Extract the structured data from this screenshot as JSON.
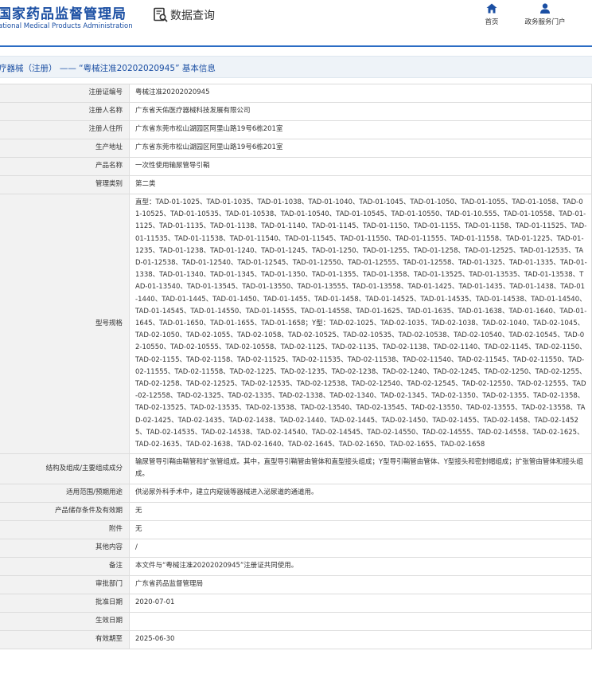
{
  "header": {
    "logo_cn": "国家药品监督管理局",
    "logo_en": "ational Medical Products Administration",
    "query_title": "数据查询",
    "nav": [
      {
        "label": "首页",
        "icon": "home-icon"
      },
      {
        "label": "政务服务门户",
        "icon": "user-icon"
      }
    ],
    "accent_color": "#1b4fa3"
  },
  "page_title": "疗器械（注册） —— “粤械注准20202020945” 基本信息",
  "fields": {
    "reg_no": {
      "label": "注册证编号",
      "value": "粤械注准20202020945"
    },
    "registrant": {
      "label": "注册人名称",
      "value": "广东省天佑医疗器械科技发展有限公司"
    },
    "registrant_addr": {
      "label": "注册人住所",
      "value": "广东省东莞市松山湖园区阿里山路19号6栋201室"
    },
    "prod_addr": {
      "label": "生产地址",
      "value": "广东省东莞市松山湖园区阿里山路19号6栋201室"
    },
    "product_name": {
      "label": "产品名称",
      "value": "一次性使用输尿管导引鞘"
    },
    "category": {
      "label": "管理类别",
      "value": "第二类"
    },
    "model_spec": {
      "label": "型号规格",
      "value": "直型：TAD-01-1025、TAD-01-1035、TAD-01-1038、TAD-01-1040、TAD-01-1045、TAD-01-1050、TAD-01-1055、TAD-01-1058、TAD-01-10525、TAD-01-10535、TAD-01-10538、TAD-01-10540、TAD-01-10545、TAD-01-10550、TAD-01-10.555、TAD-01-10558、TAD-01-1125、TAD-01-1135、TAD-01-1138、TAD-01-1140、TAD-01-1145、TAD-01-1150、TAD-01-1155、TAD-01-1158、TAD-01-11525、TAD-01-11535、TAD-01-11538、TAD-01-11540、TAD-01-11545、TAD-01-11550、TAD-01-11555、TAD-01-11558、TAD-01-1225、TAD-01-1235、TAD-01-1238、TAD-01-1240、TAD-01-1245、TAD-01-1250、TAD-01-1255、TAD-01-1258、TAD-01-12525、TAD-01-12535、TAD-01-12538、TAD-01-12540、TAD-01-12545、TAD-01-12550、TAD-01-12555、TAD-01-12558、TAD-01-1325、TAD-01-1335、TAD-01-1338、TAD-01-1340、TAD-01-1345、TAD-01-1350、TAD-01-1355、TAD-01-1358、TAD-01-13525、TAD-01-13535、TAD-01-13538、TAD-01-13540、TAD-01-13545、TAD-01-13550、TAD-01-13555、TAD-01-13558、TAD-01-1425、TAD-01-1435、TAD-01-1438、TAD-01-1440、TAD-01-1445、TAD-01-1450、TAD-01-1455、TAD-01-1458、TAD-01-14525、TAD-01-14535、TAD-01-14538、TAD-01-14540、TAD-01-14545、TAD-01-14550、TAD-01-14555、TAD-01-14558、TAD-01-1625、TAD-01-1635、TAD-01-1638、TAD-01-1640、TAD-01-1645、TAD-01-1650、TAD-01-1655、TAD-01-1658；Y型：TAD-02-1025、TAD-02-1035、TAD-02-1038、TAD-02-1040、TAD-02-1045、TAD-02-1050、TAD-02-1055、TAD-02-1058、TAD-02-10525、TAD-02-10535、TAD-02-10538、TAD-02-10540、TAD-02-10545、TAD-02-10550、TAD-02-10555、TAD-02-10558、TAD-02-1125、TAD-02-1135、TAD-02-1138、TAD-02-1140、TAD-02-1145、TAD-02-1150、TAD-02-1155、TAD-02-1158、TAD-02-11525、TAD-02-11535、TAD-02-11538、TAD-02-11540、TAD-02-11545、TAD-02-11550、TAD-02-11555、TAD-02-11558、TAD-02-1225、TAD-02-1235、TAD-02-1238、TAD-02-1240、TAD-02-1245、TAD-02-1250、TAD-02-1255、TAD-02-1258、TAD-02-12525、TAD-02-12535、TAD-02-12538、TAD-02-12540、TAD-02-12545、TAD-02-12550、TAD-02-12555、TAD-02-12558、TAD-02-1325、TAD-02-1335、TAD-02-1338、TAD-02-1340、TAD-02-1345、TAD-02-1350、TAD-02-1355、TAD-02-1358、TAD-02-13525、TAD-02-13535、TAD-02-13538、TAD-02-13540、TAD-02-13545、TAD-02-13550、TAD-02-13555、TAD-02-13558、TAD-02-1425、TAD-02-1435、TAD-02-1438、TAD-02-1440、TAD-02-1445、TAD-02-1450、TAD-02-1455、TAD-02-1458、TAD-02-14525、TAD-02-14535、TAD-02-14538、TAD-02-14540、TAD-02-14545、TAD-02-14550、TAD-02-14555、TAD-02-14558、TAD-02-1625、TAD-02-1635、TAD-02-1638、TAD-02-1640、TAD-02-1645、TAD-02-1650、TAD-02-1655、TAD-02-1658"
    },
    "structure": {
      "label": "结构及组成/主要组成成分",
      "value": "输尿管导引鞘由鞘管和扩张管组成。其中，直型导引鞘管由管体和直型接头组成；Y型导引鞘管由管体、Y型接头和密封帽组成；扩张管由管体和接头组成。"
    },
    "scope": {
      "label": "适用范围/预期用途",
      "value": "供泌尿外科手术中，建立内窥镜等器械进入泌尿道的通道用。"
    },
    "storage": {
      "label": "产品储存条件及有效期",
      "value": "无"
    },
    "attachment": {
      "label": "附件",
      "value": "无"
    },
    "other": {
      "label": "其他内容",
      "value": "/"
    },
    "remark": {
      "label": "备注",
      "value": "本文件与“粤械注准20202020945”注册证共同使用。"
    },
    "authority": {
      "label": "审批部门",
      "value": "广东省药品监督管理局"
    },
    "approval_date": {
      "label": "批准日期",
      "value": "2020-07-01"
    },
    "effective_date": {
      "label": "生效日期",
      "value": ""
    },
    "expiry_date": {
      "label": "有效期至",
      "value": "2025-06-30"
    }
  }
}
